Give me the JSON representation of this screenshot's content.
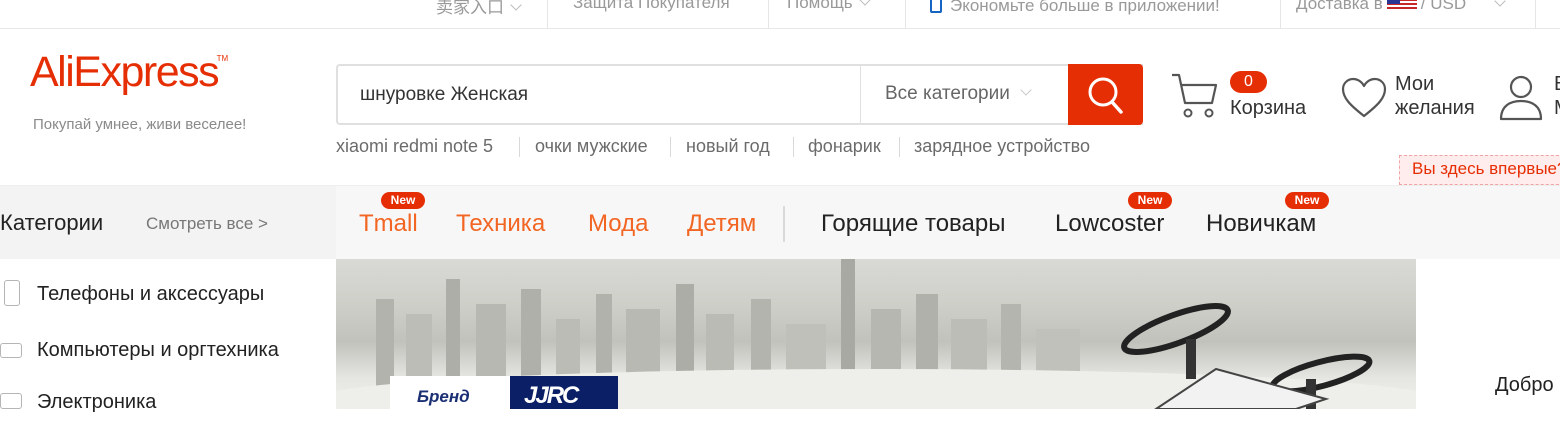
{
  "topbar": {
    "seller": "卖家入口",
    "buyer_protection": "Защита Покупателя",
    "help": "Помощь",
    "app_promo": "Экономьте больше в приложении!",
    "delivery_label": "Доставка в",
    "currency": "/ USD"
  },
  "logo": {
    "text_a": "Ali",
    "text_b": "Express",
    "tm": "TM",
    "slogan": "Покупай умнее, живи веселее!"
  },
  "search": {
    "query": "шнуровке Женская",
    "category": "Все категории"
  },
  "hot_searches": [
    "xiaomi redmi note 5",
    "очки мужские",
    "новый год",
    "фонарик",
    "зарядное устройство"
  ],
  "cart": {
    "count": "0",
    "label": "Корзина"
  },
  "wishlist": {
    "line1": "Мои",
    "line2": "желания"
  },
  "account": {
    "line1": "В",
    "line2": "М",
    "first_visit": "Вы здесь впервые?"
  },
  "nav": {
    "categories_title": "Категории",
    "see_all": "Смотреть все >",
    "badge": "New",
    "items": [
      "Tmall",
      "Техника",
      "Мода",
      "Детям",
      "Горящие товары",
      "Lowcoster",
      "Новичкам"
    ]
  },
  "sidebar": {
    "items": [
      "Телефоны и аксессуары",
      "Компьютеры и оргтехника",
      "Электроника"
    ]
  },
  "banner": {
    "brand_label": "Бренд",
    "brand_logo": "JJRC"
  },
  "welcome_right": "Добро",
  "colors": {
    "accent": "#e62e04",
    "nav_orange": "#f26522",
    "brand_navy": "#0b1f66"
  }
}
